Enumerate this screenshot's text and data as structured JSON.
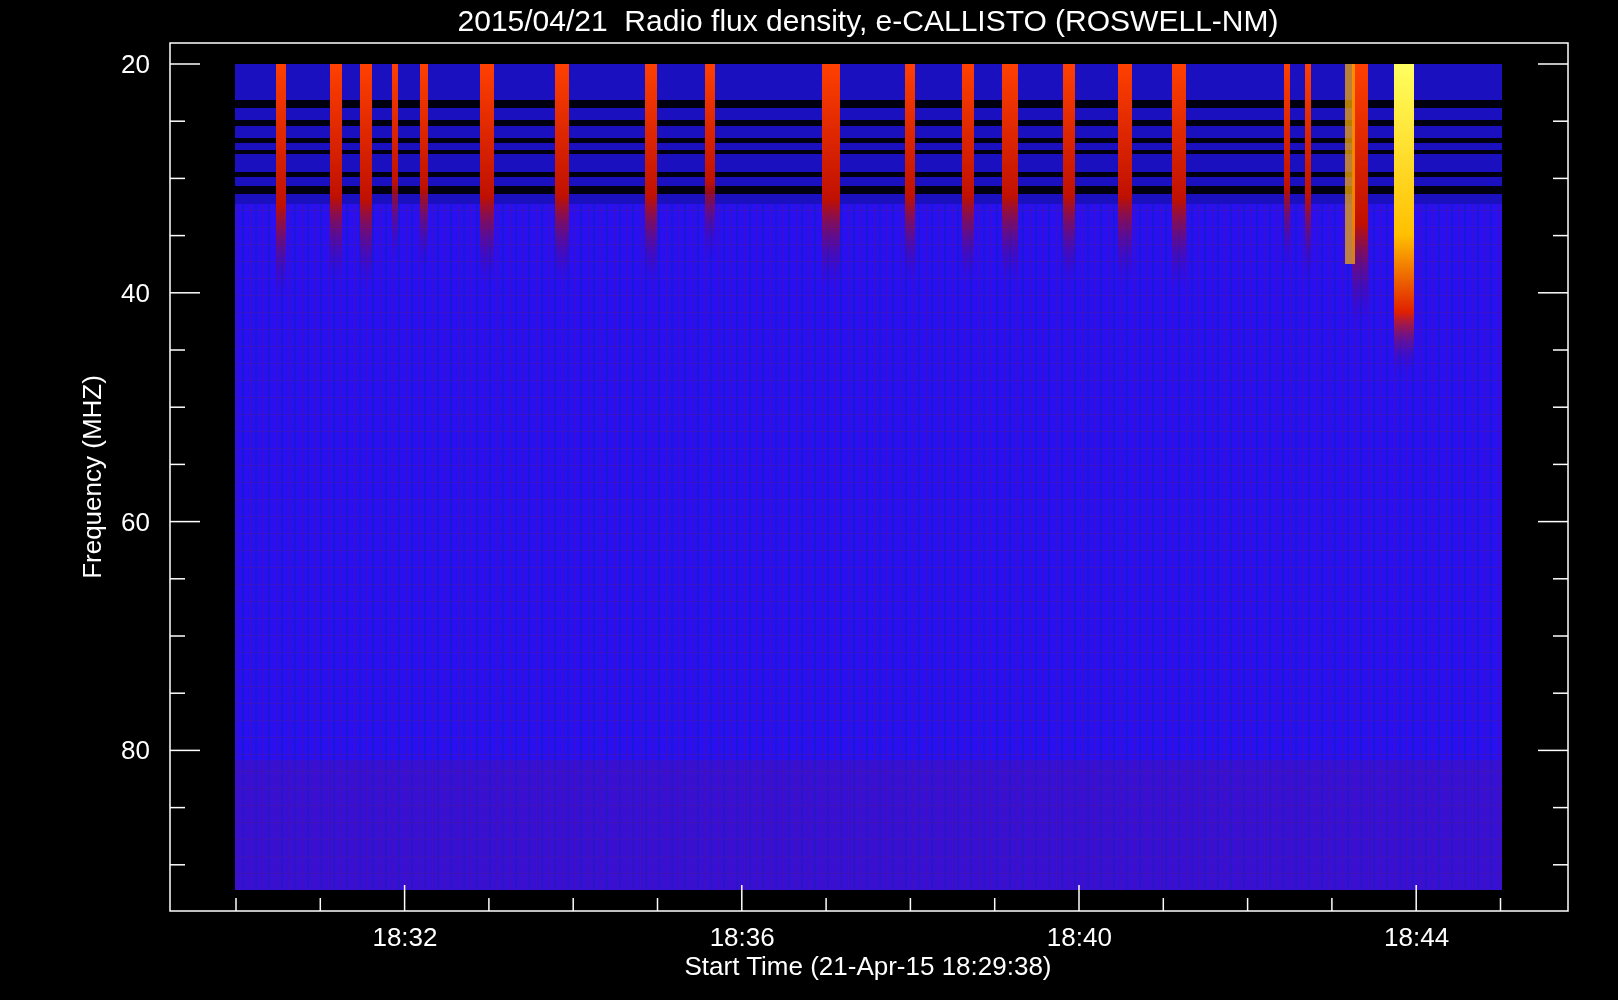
{
  "plot": {
    "title": "2015/04/21  Radio flux density, e-CALLISTO (ROSWELL-NM)",
    "y_axis": {
      "label": "Frequency (MHZ)",
      "ticks": [
        "20",
        "40",
        "60",
        "80"
      ]
    },
    "x_axis": {
      "label": "Start Time (21-Apr-15 18:29:38)",
      "ticks": [
        "18:32",
        "18:36",
        "18:40",
        "18:44"
      ]
    }
  }
}
